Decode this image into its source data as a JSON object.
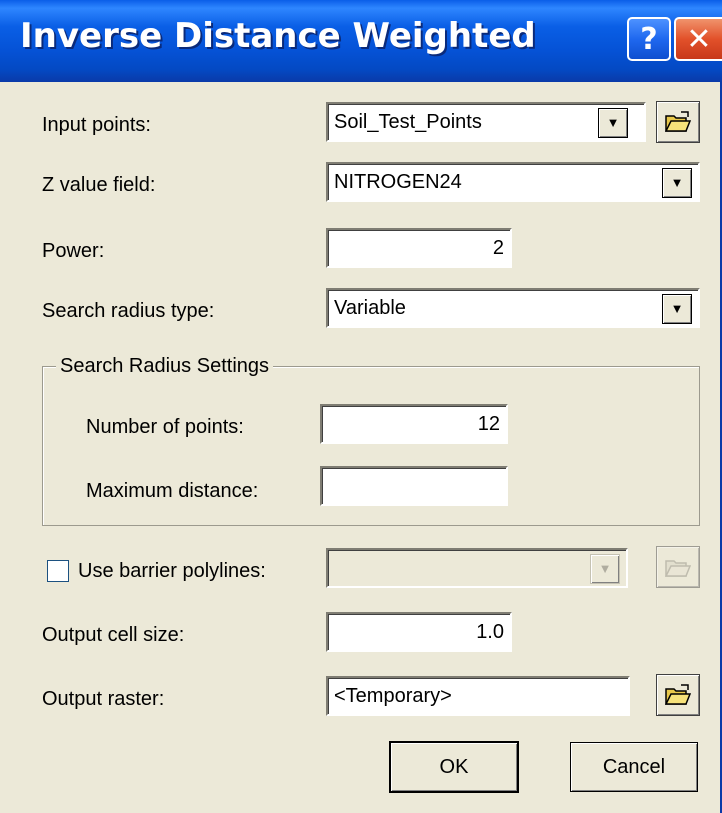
{
  "window": {
    "title": "Inverse Distance Weighted",
    "help_symbol": "?",
    "close_symbol": "✕"
  },
  "fields": {
    "input_points": {
      "label": "Input points:",
      "value": "Soil_Test_Points"
    },
    "z_value_field": {
      "label": "Z value field:",
      "value": "NITROGEN24"
    },
    "power": {
      "label": "Power:",
      "value": "2"
    },
    "search_radius_type": {
      "label": "Search radius type:",
      "value": "Variable"
    },
    "number_of_points": {
      "label": "Number of points:",
      "value": "12"
    },
    "maximum_distance": {
      "label": "Maximum distance:",
      "value": ""
    },
    "barrier": {
      "label": "Use barrier polylines:",
      "checked": false,
      "value": ""
    },
    "output_cell_size": {
      "label": "Output cell size:",
      "value": "1.0"
    },
    "output_raster": {
      "label": "Output raster:",
      "value": "<Temporary>"
    }
  },
  "groupbox": {
    "title": "Search Radius Settings"
  },
  "buttons": {
    "ok": "OK",
    "cancel": "Cancel"
  },
  "icons": {
    "dropdown": "▼",
    "folder": "open-folder-icon"
  },
  "colors": {
    "titlebar": "#0552d6",
    "dialog_bg": "#ece9d8",
    "close_button": "#e2512a"
  }
}
